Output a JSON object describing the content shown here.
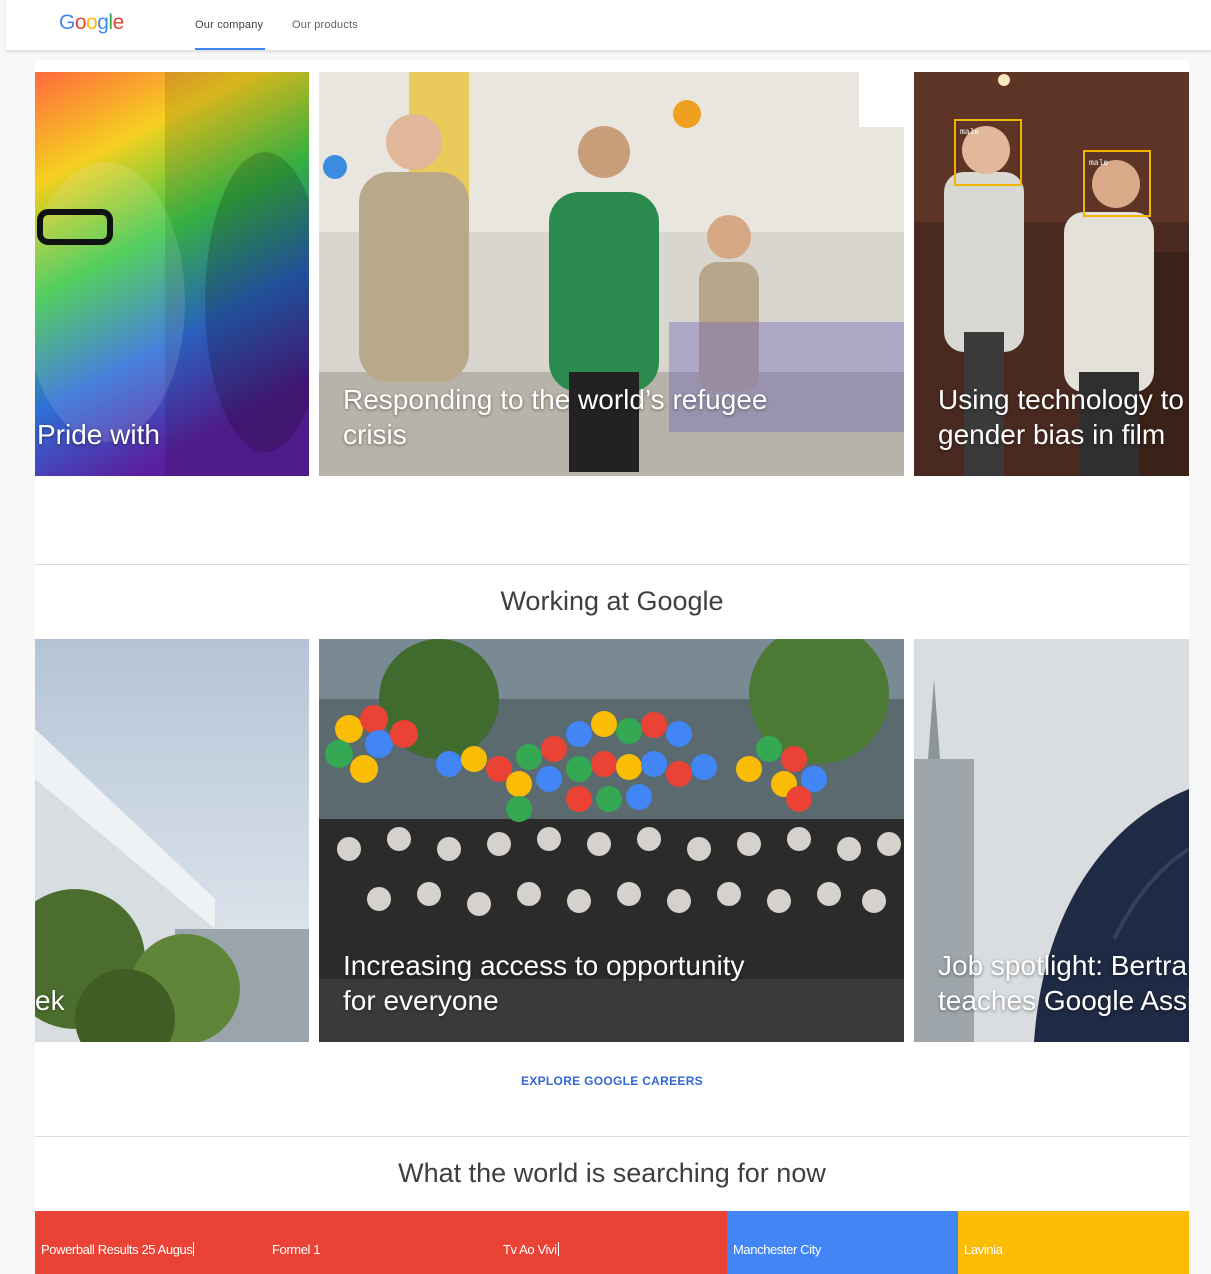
{
  "header": {
    "logo_letters": [
      "G",
      "o",
      "o",
      "g",
      "l",
      "e"
    ],
    "logo_colors": [
      "#4285f4",
      "#ea4335",
      "#fbbc05",
      "#4285f4",
      "#34a853",
      "#ea4335"
    ],
    "tabs": [
      {
        "label": "Our company",
        "active": true
      },
      {
        "label": "Our products",
        "active": false
      }
    ]
  },
  "stories": {
    "cards": [
      {
        "caption_lines": [
          "Pride with",
          ""
        ]
      },
      {
        "caption_lines": [
          "Responding to the world’s refugee",
          "crisis"
        ]
      },
      {
        "caption_lines": [
          "Using technology to",
          "gender bias in film"
        ],
        "tag_labels": [
          "male",
          "male"
        ]
      }
    ]
  },
  "working": {
    "title": "Working at Google",
    "cards": [
      {
        "caption_lines": [
          "",
          "ek"
        ]
      },
      {
        "caption_lines": [
          "Increasing access to opportunity",
          "for everyone"
        ]
      },
      {
        "caption_lines": [
          "Job spotlight: Bertrar",
          "teaches Google Assi"
        ]
      }
    ],
    "cta_label": "EXPLORE GOOGLE CAREERS"
  },
  "trending": {
    "title": "What the world is searching for now",
    "items": [
      {
        "label": "Powerball Results 25 Augus",
        "color": "#ea4335",
        "typing": true
      },
      {
        "label": "Formel 1",
        "color": "#ea4335",
        "typing": false
      },
      {
        "label": "Tv Ao Vivi",
        "color": "#ea4335",
        "typing": true
      },
      {
        "label": "Manchester City",
        "color": "#4285f4",
        "typing": false
      },
      {
        "label": "Lavinia",
        "color": "#fbbc05",
        "typing": false
      }
    ]
  },
  "colors": {
    "accent": "#4285f4",
    "cta": "#3367d6",
    "divider": "#dadce0"
  }
}
